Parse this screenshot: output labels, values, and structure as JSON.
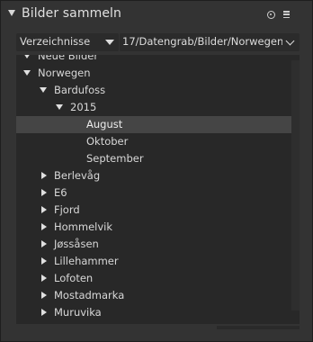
{
  "header": {
    "title": "Bilder sammeln",
    "collapse_icon": "triangle-down",
    "info_icon": "info-circle",
    "menu_icon": "hamburger"
  },
  "controls": {
    "mode": "Verzeichnisse",
    "path": "17/Datengrab/Bilder/Norwegen"
  },
  "tree": {
    "rows": [
      {
        "label": "Neue Bilder",
        "expander": "down",
        "depth": 0
      },
      {
        "label": "Norwegen",
        "expander": "down",
        "depth": 0
      },
      {
        "label": "Bardufoss",
        "expander": "down",
        "depth": 1
      },
      {
        "label": "2015",
        "expander": "down",
        "depth": 2
      },
      {
        "label": "August",
        "expander": "none",
        "depth": 3,
        "selected": true
      },
      {
        "label": "Oktober",
        "expander": "none",
        "depth": 3
      },
      {
        "label": "September",
        "expander": "none",
        "depth": 3
      },
      {
        "label": "Berlevåg",
        "expander": "right",
        "depth": 1
      },
      {
        "label": "E6",
        "expander": "right",
        "depth": 1
      },
      {
        "label": "Fjord",
        "expander": "right",
        "depth": 1
      },
      {
        "label": "Hommelvik",
        "expander": "right",
        "depth": 1
      },
      {
        "label": "Jøssåsen",
        "expander": "right",
        "depth": 1
      },
      {
        "label": "Lillehammer",
        "expander": "right",
        "depth": 1
      },
      {
        "label": "Lofoten",
        "expander": "right",
        "depth": 1
      },
      {
        "label": "Mostadmarka",
        "expander": "right",
        "depth": 1
      },
      {
        "label": "Muruvika",
        "expander": "right",
        "depth": 1
      },
      {
        "label": "",
        "expander": "right",
        "depth": 1
      }
    ]
  },
  "colors": {
    "panel_bg": "#333333",
    "tree_bg": "#282828",
    "selected_row_bg": "#454545",
    "text": "#d8d8d8"
  }
}
